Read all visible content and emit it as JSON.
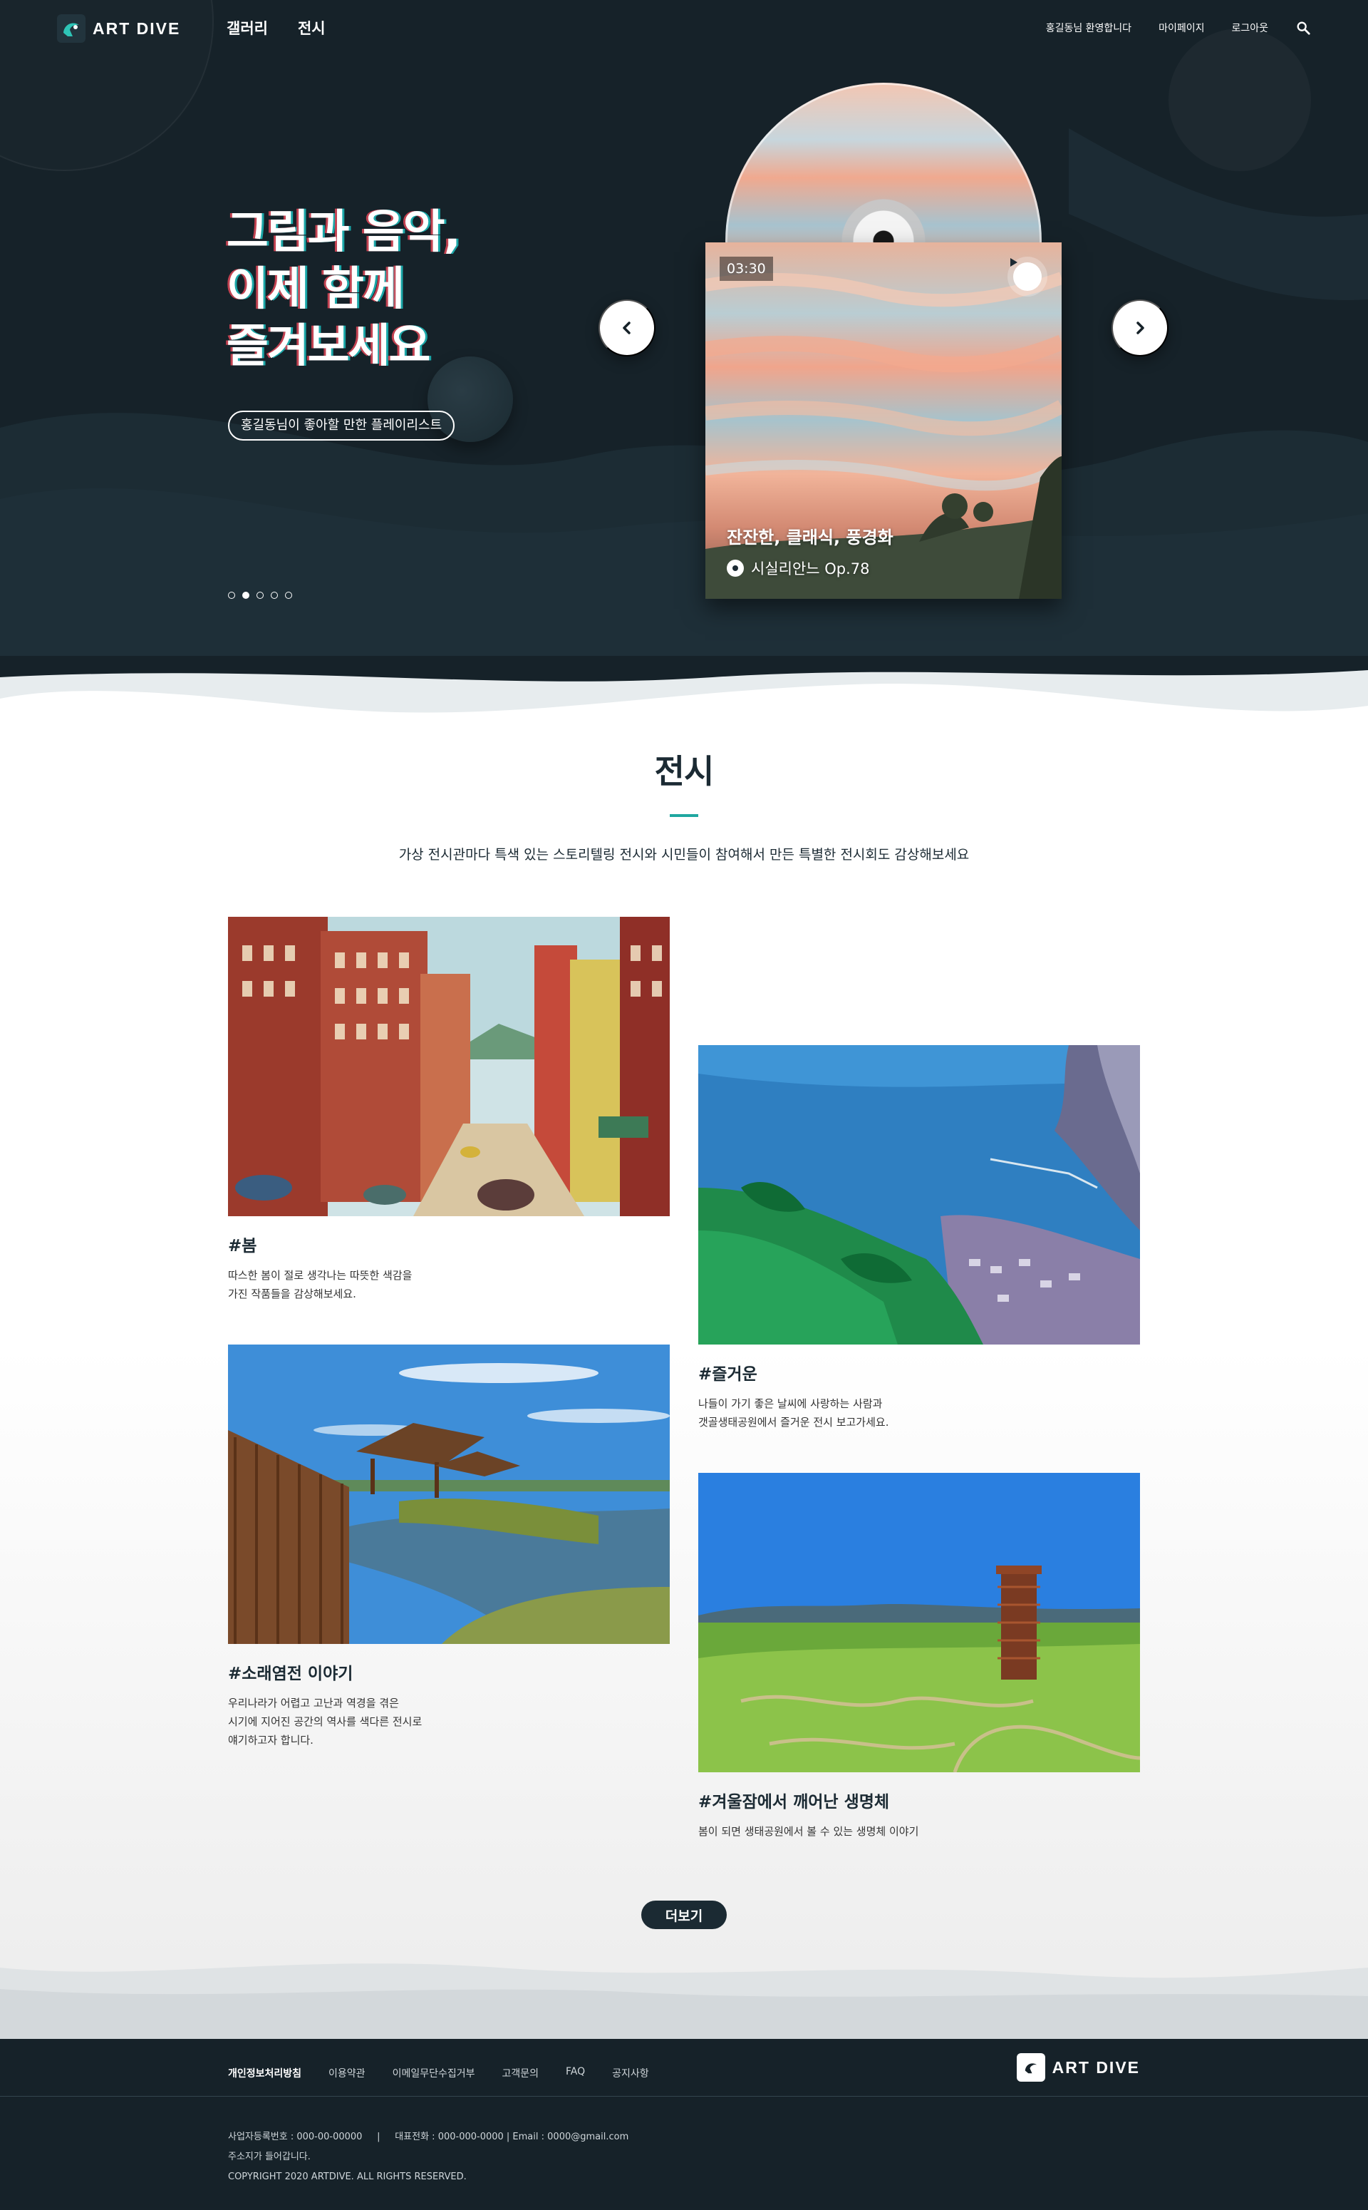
{
  "brand": {
    "name": "ART DIVE",
    "accent": "#1fa7a0",
    "dark": "#162229"
  },
  "nav": {
    "menu": [
      "갤러리",
      "전시"
    ],
    "util": {
      "welcome": "홍길동님 환영합니다",
      "mypage": "마이페이지",
      "logout": "로그아웃"
    },
    "search_icon": "search-icon"
  },
  "hero": {
    "title": "그림과 음악,\n이제 함께\n즐겨보세요",
    "pill": "홍길동님이 좋아할 만한 플레이리스트",
    "slides_total": 5,
    "active_slide": 2,
    "album": {
      "time": "03:30",
      "title": "잔잔한, 클래식, 풍경화",
      "track": "시실리안느 Op.78"
    }
  },
  "exhibition": {
    "title": "전시",
    "description": "가상 전시관마다 특색 있는 스토리텔링 전시와 시민들이 참여해서 만든 특별한 전시회도 감상해보세요",
    "cards": [
      {
        "tag": "#봄",
        "desc": "따스한 봄이 절로 생각나는 따뜻한 색감을\n가진 작품들을 감상해보세요."
      },
      {
        "tag": "#즐거운",
        "desc": "나들이 가기 좋은 날씨에 사랑하는 사람과\n갯골생태공원에서 즐거운 전시 보고가세요."
      },
      {
        "tag": "#소래염전 이야기",
        "desc": "우리나라가 어렵고 고난과 역경을 겪은\n시기에 지어진 공간의 역사를 색다른 전시로\n얘기하고자 합니다."
      },
      {
        "tag": "#겨울잠에서 깨어난 생명체",
        "desc": "봄이 되면 생태공원에서 볼 수 있는 생명체 이야기"
      }
    ],
    "more": "더보기"
  },
  "footer": {
    "links": [
      "개인정보처리방침",
      "이용약관",
      "이메일무단수집거부",
      "고객문의",
      "FAQ",
      "공지사항"
    ],
    "info": {
      "line1_biz": "사업자등록번호 : 000-00-00000",
      "line1_sep": "|",
      "line1_tel": "대표전화 : 000-000-0000",
      "line1_email": "| Email : 0000@gmail.com",
      "address": "주소지가 들어갑니다.",
      "copyright": "COPYRIGHT 2020 ARTDIVE. ALL RIGHTS RESERVED."
    }
  }
}
